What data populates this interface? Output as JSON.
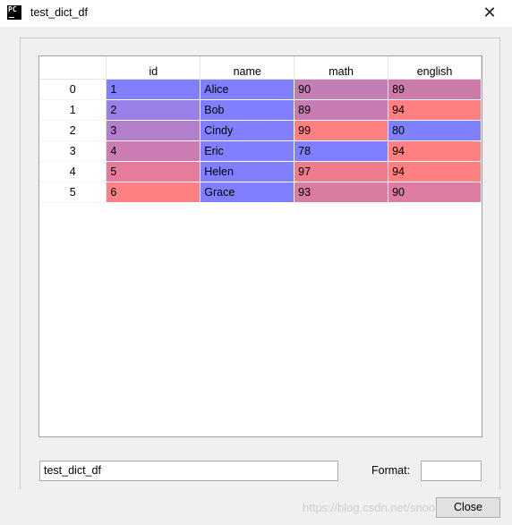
{
  "window": {
    "title": "test_dict_df",
    "app_icon_text": "PC",
    "close_glyph": "✕"
  },
  "table": {
    "columns": [
      "id",
      "name",
      "math",
      "english"
    ],
    "rows": [
      {
        "index": "0",
        "cells": [
          "1",
          "Alice",
          "90",
          "89"
        ],
        "colors": [
          "#8080ff",
          "#8080ff",
          "#c27eb4",
          "#cc7ba9"
        ]
      },
      {
        "index": "1",
        "cells": [
          "2",
          "Bob",
          "89",
          "94"
        ],
        "colors": [
          "#9a80e6",
          "#8080ff",
          "#c67cb0",
          "#ff8080"
        ]
      },
      {
        "index": "2",
        "cells": [
          "3",
          "Cindy",
          "99",
          "80"
        ],
        "colors": [
          "#b37ecc",
          "#8080ff",
          "#ff8080",
          "#8080ff"
        ]
      },
      {
        "index": "3",
        "cells": [
          "4",
          "Eric",
          "78",
          "94"
        ],
        "colors": [
          "#cc7cb3",
          "#8080ff",
          "#8080ff",
          "#ff8080"
        ]
      },
      {
        "index": "4",
        "cells": [
          "5",
          "Helen",
          "97",
          "94"
        ],
        "colors": [
          "#e67c99",
          "#8080ff",
          "#f07b8c",
          "#ff8080"
        ]
      },
      {
        "index": "5",
        "cells": [
          "6",
          "Grace",
          "93",
          "90"
        ],
        "colors": [
          "#ff8080",
          "#8080ff",
          "#d87ca0",
          "#db7ca0"
        ]
      }
    ]
  },
  "footer": {
    "name_value": "test_dict_df",
    "format_label": "Format:",
    "format_value": "",
    "close_label": "Close"
  },
  "watermark": "https://blog.csdn.net/snoopy_yei"
}
